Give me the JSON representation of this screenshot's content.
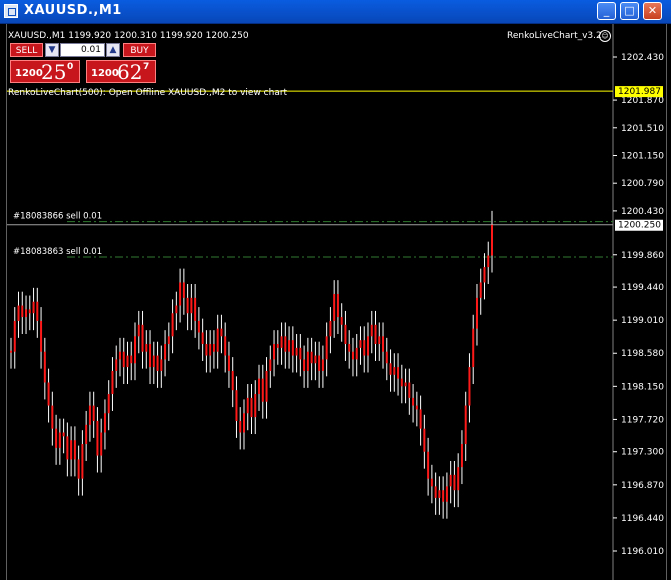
{
  "window": {
    "title": "XAUUSD.,M1",
    "minimize_label": "_",
    "maximize_label": "□",
    "close_label": "✕"
  },
  "chart_header": {
    "symbol_line": "XAUUSD.,M1  1199.920 1200.310 1199.920 1200.250",
    "indicator_name": "RenkoLiveChart_v3.2",
    "status_text": "RenkoLiveChart(500): Open Offline XAUUSD.,M2 to view chart"
  },
  "trade_panel": {
    "sell_label": "SELL",
    "buy_label": "BUY",
    "lot_value": "0.01",
    "down_arrow": "▼",
    "up_arrow": "▲",
    "sell_price": {
      "small": "1200",
      "big": "25",
      "sup": "0"
    },
    "buy_price": {
      "small": "1200",
      "big": "62",
      "sup": "7"
    }
  },
  "order_lines": [
    {
      "label": "#18083866 sell 0.01",
      "price": 1200.29
    },
    {
      "label": "#18083863 sell 0.01",
      "price": 1199.83
    }
  ],
  "price_markers": {
    "bid_line": {
      "label": "1201.987",
      "price": 1201.987,
      "color": "#ffff00"
    },
    "current": {
      "label": "1200.250",
      "price": 1200.25
    }
  },
  "colors": {
    "candle": "#ff1a1a",
    "wick": "#ffffff",
    "order_line": "#2f7a2f",
    "grid_text": "#ffffff"
  },
  "chart_data": {
    "type": "line",
    "ylim": [
      1195.9,
      1202.65
    ],
    "y_ticks": [
      "1202.430",
      "1201.870",
      "1201.510",
      "1201.150",
      "1200.790",
      "1200.430",
      "1199.860",
      "1199.440",
      "1199.010",
      "1198.580",
      "1198.150",
      "1197.720",
      "1197.300",
      "1196.870",
      "1196.440",
      "1196.010"
    ],
    "y_tick_values": [
      1202.43,
      1201.87,
      1201.51,
      1201.15,
      1200.79,
      1200.43,
      1199.86,
      1199.44,
      1199.01,
      1198.58,
      1198.15,
      1197.72,
      1197.3,
      1196.87,
      1196.44,
      1196.01
    ],
    "series": [
      {
        "values": [
          1198.6,
          1199.0,
          1199.2,
          1199.05,
          1199.15,
          1199.1,
          1199.25,
          1199.0,
          1198.6,
          1198.2,
          1197.9,
          1197.6,
          1197.35,
          1197.55,
          1197.5,
          1197.2,
          1197.45,
          1197.2,
          1196.95,
          1197.4,
          1197.65,
          1197.9,
          1197.7,
          1197.25,
          1197.55,
          1197.8,
          1198.05,
          1198.35,
          1198.5,
          1198.6,
          1198.4,
          1198.55,
          1198.45,
          1198.8,
          1198.95,
          1198.6,
          1198.7,
          1198.4,
          1198.55,
          1198.35,
          1198.5,
          1198.7,
          1198.8,
          1199.1,
          1199.2,
          1199.5,
          1199.3,
          1199.1,
          1199.3,
          1199.0,
          1198.85,
          1198.7,
          1198.55,
          1198.7,
          1198.6,
          1198.9,
          1198.8,
          1198.55,
          1198.35,
          1198.1,
          1197.7,
          1197.55,
          1197.8,
          1198.0,
          1197.75,
          1198.05,
          1198.25,
          1197.95,
          1198.35,
          1198.5,
          1198.7,
          1198.65,
          1198.8,
          1198.6,
          1198.75,
          1198.55,
          1198.65,
          1198.5,
          1198.35,
          1198.6,
          1198.45,
          1198.55,
          1198.35,
          1198.5,
          1198.8,
          1199.0,
          1199.35,
          1199.05,
          1198.95,
          1198.7,
          1198.6,
          1198.5,
          1198.65,
          1198.75,
          1198.55,
          1198.8,
          1198.95,
          1198.7,
          1198.8,
          1198.6,
          1198.45,
          1198.3,
          1198.4,
          1198.25,
          1198.15,
          1198.2,
          1198.0,
          1197.9,
          1197.85,
          1197.6,
          1197.3,
          1196.95,
          1196.85,
          1196.7,
          1196.8,
          1196.65,
          1196.85,
          1197.0,
          1196.8,
          1197.1,
          1197.4,
          1197.9,
          1198.4,
          1198.9,
          1199.3,
          1199.5,
          1199.7,
          1199.85,
          1200.25
        ]
      }
    ]
  }
}
